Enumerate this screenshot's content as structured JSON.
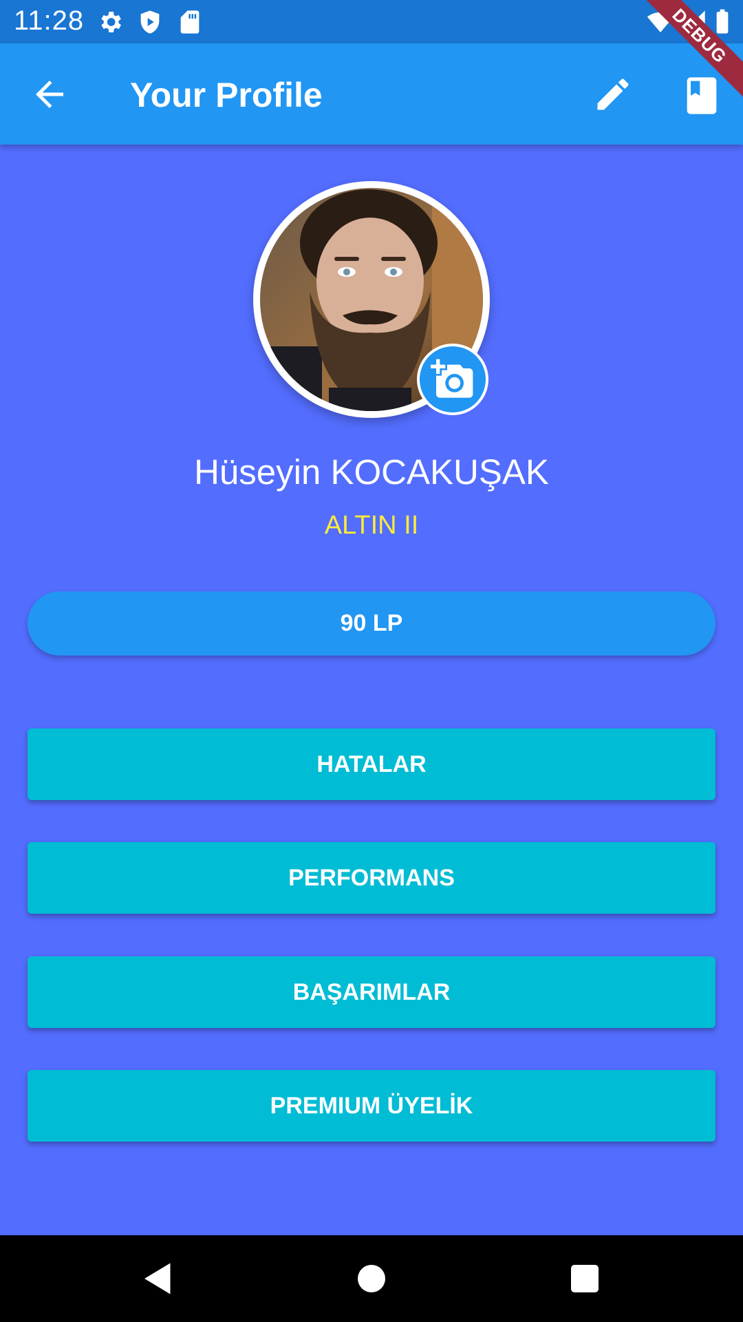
{
  "status_bar": {
    "time": "11:28",
    "icons": [
      "settings-icon",
      "shield-play-icon",
      "sd-card-icon",
      "wifi-icon",
      "signal-icon",
      "battery-icon"
    ]
  },
  "debug_label": "DEBUG",
  "app_bar": {
    "title": "Your Profile",
    "icons": [
      "back-arrow-icon",
      "edit-icon",
      "book-icon"
    ]
  },
  "profile": {
    "name": "Hüseyin KOCAKUŞAK",
    "rank": "ALTIN II",
    "lp": "90 LP"
  },
  "menu": [
    {
      "label": "HATALAR"
    },
    {
      "label": "PERFORMANS"
    },
    {
      "label": "BAŞARIMLAR"
    },
    {
      "label": "PREMIUM ÜYELİK"
    }
  ],
  "colors": {
    "background": "#536dfe",
    "app_bar": "#2196f3",
    "status_bar": "#1976d2",
    "menu_button": "#00bcd4",
    "rank_text": "#ffeb3b"
  }
}
